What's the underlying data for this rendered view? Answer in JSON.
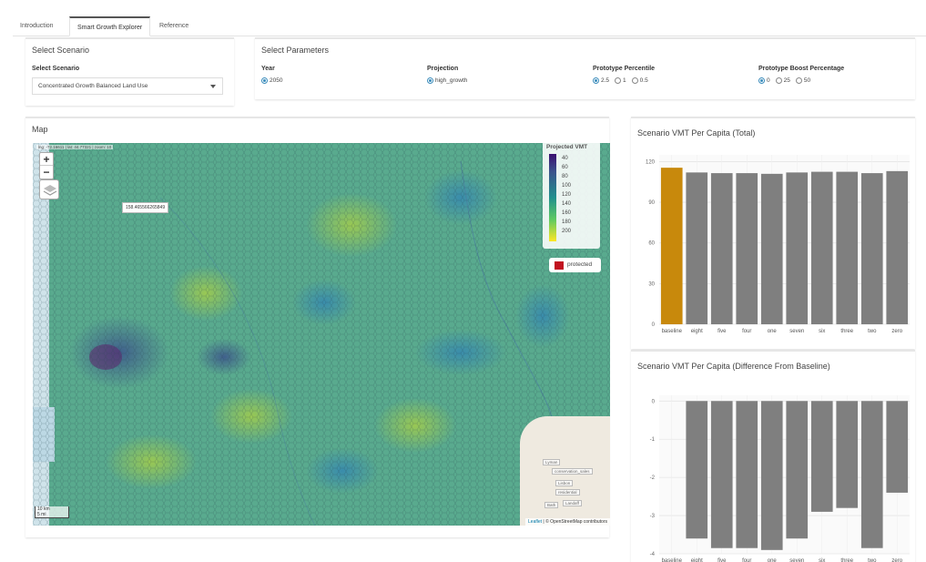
{
  "tabs": [
    "Introduction",
    "Smart Growth Explorer",
    "Reference"
  ],
  "scenario_panel": {
    "title": "Select Scenario",
    "label": "Select Scenario",
    "selected": "Concentrated Growth Balanced Land Use"
  },
  "params_panel": {
    "title": "Select Parameters",
    "year": {
      "label": "Year",
      "options": [
        "2050"
      ],
      "selected": "2050"
    },
    "projection": {
      "label": "Projection",
      "options": [
        "high_growth"
      ],
      "selected": "high_growth"
    },
    "percentile": {
      "label": "Prototype Percentile",
      "options": [
        "2.5",
        "1",
        "0.5"
      ],
      "selected": "2.5"
    },
    "boost": {
      "label": "Prototype Boost Percentage",
      "options": [
        "0",
        "25",
        "50"
      ],
      "selected": "0"
    }
  },
  "map_panel": {
    "title": "Map",
    "coords": "lng: -72.16611 | lat: 44.77321 | zoom: 10",
    "zoom_in": "+",
    "zoom_out": "−",
    "popup": "158.465566265849",
    "legend_title": "Projected VMT",
    "legend_ticks": [
      "40",
      "60",
      "80",
      "100",
      "120",
      "140",
      "160",
      "180",
      "200"
    ],
    "protected_label": "protected",
    "scale_km": "10 km",
    "scale_mi": "5 mi",
    "attribution_leaflet": "Leaflet",
    "attribution_rest": " | © OpenStreetMap contributors",
    "inset_labels": [
      "Lyman",
      "conservation_sales",
      "Lisbon",
      "residential",
      "Bath",
      "Landaff"
    ],
    "colors": {
      "base": "#5fae93",
      "protected": "#c1121f"
    }
  },
  "chart_total": {
    "title": "Scenario VMT Per Capita (Total)",
    "chart_data": {
      "type": "bar",
      "categories": [
        "baseline",
        "eight",
        "five",
        "four",
        "one",
        "seven",
        "six",
        "three",
        "two",
        "zero"
      ],
      "values": [
        115.5,
        112,
        111.5,
        111.5,
        111,
        112,
        112.5,
        112.5,
        111.5,
        113
      ],
      "ylim": [
        0,
        125
      ],
      "yticks": [
        0,
        30,
        60,
        90,
        120
      ],
      "highlight_color": "#c8890c",
      "bar_color": "#7f7f7f",
      "grid": true
    }
  },
  "chart_diff": {
    "title": "Scenario VMT Per Capita (Difference From Baseline)",
    "chart_data": {
      "type": "bar",
      "categories": [
        "baseline",
        "eight",
        "five",
        "four",
        "one",
        "seven",
        "six",
        "three",
        "two",
        "zero"
      ],
      "values": [
        0,
        -3.6,
        -3.85,
        -3.85,
        -3.9,
        -3.6,
        -2.9,
        -2.8,
        -3.85,
        -2.4
      ],
      "ylim": [
        -4,
        0.15
      ],
      "yticks": [
        0,
        -1,
        -2,
        -3,
        -4
      ],
      "bar_color": "#7f7f7f",
      "grid": true
    }
  }
}
